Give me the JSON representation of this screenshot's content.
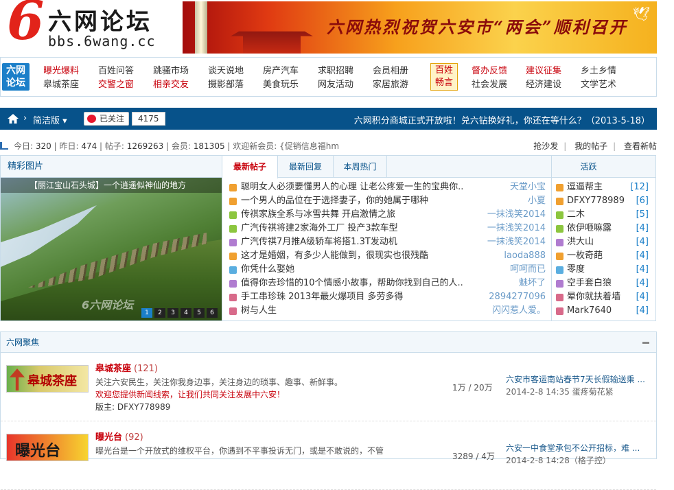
{
  "header": {
    "logo_six": "6",
    "logo_cn": "六网论坛",
    "logo_url": "bbs.6wang.cc",
    "banner_slogan": "六网热烈祝贺六安市“两会”顺利召开"
  },
  "catnav": {
    "badge": "六网论坛",
    "cols": [
      {
        "top": "曝光爆料",
        "bottom": "皋城茶座",
        "top_red": true,
        "bottom_red": false
      },
      {
        "top": "百姓问答",
        "bottom": "交警之窗",
        "top_red": false,
        "bottom_red": true
      },
      {
        "top": "跳骚市场",
        "bottom": "相亲交友",
        "top_red": false,
        "bottom_red": true
      },
      {
        "top": "谈天说地",
        "bottom": "摄影部落",
        "top_red": false,
        "bottom_red": false
      },
      {
        "top": "房产汽车",
        "bottom": "美食玩乐",
        "top_red": false,
        "bottom_red": false
      },
      {
        "top": "求职招聘",
        "bottom": "网友活动",
        "top_red": false,
        "bottom_red": false
      },
      {
        "top": "会员相册",
        "bottom": "家居旅游",
        "top_red": false,
        "bottom_red": false
      }
    ],
    "baixing": "百姓畅言",
    "cols2": [
      {
        "top": "督办反馈",
        "bottom": "社会发展",
        "top_red": true,
        "bottom_red": false
      },
      {
        "top": "建议征集",
        "bottom": "经济建设",
        "top_red": true,
        "bottom_red": false
      },
      {
        "top": "乡土乡情",
        "bottom": "文学艺术",
        "top_red": false,
        "bottom_red": false
      }
    ]
  },
  "bluebar": {
    "crumb_sep": "›",
    "version": "简洁版 ▾",
    "follow": "已关注",
    "follow_count": "4175",
    "notice": "六网积分商城正式开放啦！兑六钻换好礼，你还在等什么？（2013-5-18）"
  },
  "stats": {
    "today_label": "今日:",
    "today": "320",
    "yesterday_label": "昨日:",
    "yesterday": "474",
    "posts_label": "帖子:",
    "posts": "1269263",
    "members_label": "会员:",
    "members": "181305",
    "welcome": "欢迎新会员: {促销信息福hm",
    "links": [
      "抢沙发",
      "我的帖子",
      "查看新帖"
    ]
  },
  "pictures": {
    "title": "精彩图片",
    "caption": "【丽江宝山石头城】一个逍遥似神仙的地方",
    "watermark": "6六网论坛",
    "dots": [
      "1",
      "2",
      "3",
      "4",
      "5",
      "6"
    ]
  },
  "posts": {
    "tabs": [
      "最新帖子",
      "最新回复",
      "本周热门"
    ],
    "items": [
      {
        "title": "聪明女人必须要懂男人的心理 让老公疼爱一生的宝典你..",
        "user": "天堂小宝",
        "icon": "#f0a030"
      },
      {
        "title": "一个男人的品位在于选择妻子，你的她属于哪种",
        "user": "小夏",
        "icon": "#f0a030"
      },
      {
        "title": "传祺家族全系与冰雪共舞 开启激情之旅",
        "user": "一抹浅笑2014",
        "icon": "#8cc63f"
      },
      {
        "title": "广汽传祺将建2家海外工厂 投产3款车型",
        "user": "一抹浅笑2014",
        "icon": "#8cc63f"
      },
      {
        "title": "广汽传祺7月推A级轿车将搭1.3T发动机",
        "user": "一抹浅笑2014",
        "icon": "#b07cd0"
      },
      {
        "title": "这才是婚姻，有多少人能做到，很现实也很残酷",
        "user": "laoda888",
        "icon": "#f0a030"
      },
      {
        "title": "你凭什么娶她",
        "user": "呵呵而已",
        "icon": "#5aaee0"
      },
      {
        "title": "值得你去珍惜的10个情感小故事，帮助你找到自己的人..",
        "user": "魅坏了",
        "icon": "#b07cd0"
      },
      {
        "title": "手工串珍珠 2013年最火爆项目 多劳多得",
        "user": "2894277096",
        "icon": "#d86a8a"
      },
      {
        "title": "树与人生",
        "user": "闪闪惹人爱。",
        "icon": "#d86a8a"
      }
    ]
  },
  "active": {
    "title": "活跃",
    "items": [
      {
        "name": "逗逼帮主",
        "count": "[12]",
        "icon": "#f0a030"
      },
      {
        "name": "DFXY778989",
        "count": "[6]",
        "icon": "#f0a030"
      },
      {
        "name": "二木",
        "count": "[5]",
        "icon": "#8cc63f"
      },
      {
        "name": "依伊咂嘛露",
        "count": "[4]",
        "icon": "#8cc63f"
      },
      {
        "name": "洪大山",
        "count": "[4]",
        "icon": "#b07cd0"
      },
      {
        "name": "一枚奇葩",
        "count": "[4]",
        "icon": "#f0a030"
      },
      {
        "name": "零度",
        "count": "[4]",
        "icon": "#5aaee0"
      },
      {
        "name": "空手套白狼",
        "count": "[4]",
        "icon": "#b07cd0"
      },
      {
        "name": "晕你就扶着墙",
        "count": "[4]",
        "icon": "#d86a8a"
      },
      {
        "name": "Mark7640",
        "count": "[4]",
        "icon": "#d86a8a"
      }
    ]
  },
  "focus": {
    "title": "六网聚焦",
    "forums": [
      {
        "thumb_text": "皋城茶座",
        "name": "皋城茶座",
        "count": "(121)",
        "desc": "关注六安民生，关注你我身边事，关注身边的琐事、趣事、新鲜事。",
        "desc_hl": "欢迎您提供新闻线索，让我们共同关注发展中六安！",
        "mod_label": "版主:",
        "mod": "DFXY778989",
        "stat": "1万 / 20万",
        "last_title": "六安市客运南站春节7天长假输送乘 ...",
        "last_meta": "2014-2-8 14:35 蛋疼菊花紧"
      },
      {
        "thumb_text": "曝光台",
        "name": "曝光台",
        "count": "(92)",
        "desc": "曝光台是一个开放式的维权平台，你遇到不平事投诉无门，或是不敢说的，不管",
        "desc_hl": "",
        "mod_label": "",
        "mod": "",
        "stat": "3289 / 4万",
        "last_title": "六安一中食堂承包不公开招标，难 ...",
        "last_meta": "2014-2-8 14:28（格子控）"
      }
    ]
  }
}
